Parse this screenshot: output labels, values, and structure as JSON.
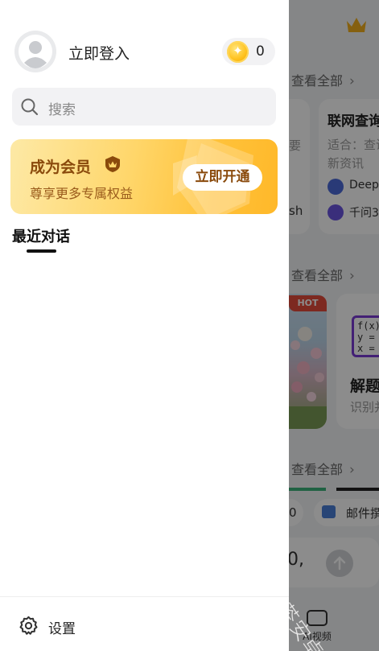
{
  "drawer": {
    "user": {
      "login_label": "立即登入",
      "coin_count": "0"
    },
    "search": {
      "placeholder": "搜索"
    },
    "vip": {
      "title": "成为会员",
      "subtitle": "尊享更多专属权益",
      "button_label": "立即开通"
    },
    "recent_tab_label": "最近对话",
    "settings_label": "设置"
  },
  "background": {
    "see_all_labels": [
      "查看全部",
      "查看全部",
      "查看全部"
    ],
    "card_title": "联网查询",
    "card_sub_line1": "适合：查询",
    "card_sub_line2": "新资讯",
    "card_model_1": "DeepS",
    "card_model_2": "千问3",
    "left_partial_char": "要",
    "left_partial_word": "sh",
    "hot_badge": "HOT",
    "formula_line1": "f(x)=",
    "formula_line2": "y =",
    "formula_line3": "x =",
    "solve_title": "解题",
    "solve_sub": "识别并",
    "pill_zero": "0",
    "mail_label": "邮件撰",
    "input_zero": "0,",
    "ai_video_label": "AI视频"
  },
  "watermark": "绿茶安卓网",
  "colors": {
    "vip_gold": "#ffc23a",
    "vip_text": "#8a4a0c",
    "coin": "#ffc21f",
    "hot_red": "#e34b3b"
  },
  "icons": [
    "avatar-icon",
    "coin-icon",
    "search-icon",
    "vip-crown-badge-icon",
    "gear-icon",
    "crown-icon",
    "video-camera-icon",
    "send-arrow-icon"
  ]
}
